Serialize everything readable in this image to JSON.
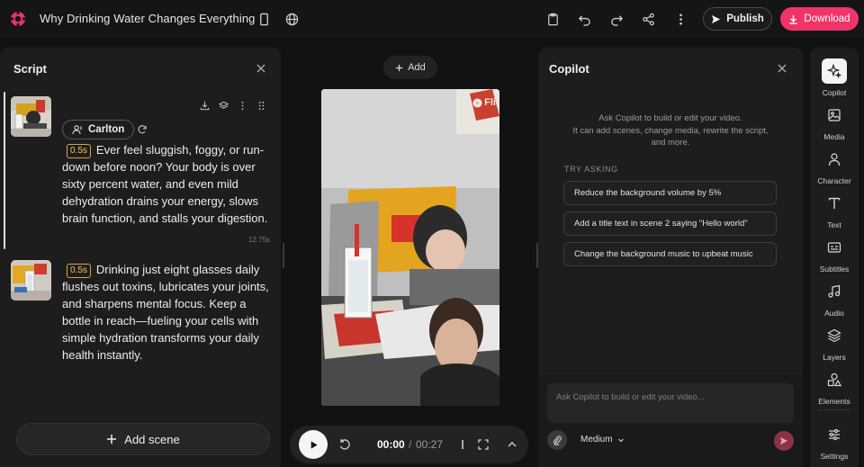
{
  "app": {
    "project_title": "Why Drinking Water Changes Everything",
    "publish_label": "Publish",
    "download_label": "Download",
    "brand_color": "#f0346a"
  },
  "script_panel": {
    "title": "Script",
    "scenes": [
      {
        "voice": "Carlton",
        "duration": "0.5s",
        "text": "Ever feel sluggish, foggy, or run-down before noon? Your body is over sixty percent water, and even mild dehydration drains your energy, slows brain function, and stalls your digestion.",
        "time": "12.75s"
      },
      {
        "duration": "0.5s",
        "text": "Drinking just eight glasses daily flushes out toxins, lubricates your joints, and sharpens mental focus. Keep a bottle in reach—fueling your cells with simple hydration transforms your daily health instantly."
      }
    ],
    "add_scene_label": "Add scene"
  },
  "center": {
    "add_label": "Add",
    "watermark": "Fli",
    "current_time": "00:00",
    "separator": "/",
    "total_time": "00:27"
  },
  "copilot": {
    "title": "Copilot",
    "intro_line1": "Ask Copilot to build or edit your video.",
    "intro_line2": "It can add scenes, change media, rewrite the script,",
    "intro_line3": "and more.",
    "try_asking_label": "TRY ASKING",
    "suggestions": [
      "Reduce the background volume by 5%",
      "Add a title text in scene 2 saying \"Hello world\"",
      "Change the background music to upbeat music"
    ],
    "input_placeholder": "Ask Copilot to build or edit your video...",
    "model": "Medium"
  },
  "rail": {
    "items": [
      {
        "label": "Copilot",
        "icon": "sparkle-icon"
      },
      {
        "label": "Media",
        "icon": "image-icon"
      },
      {
        "label": "Character",
        "icon": "person-icon"
      },
      {
        "label": "Text",
        "icon": "text-icon"
      },
      {
        "label": "Subtitles",
        "icon": "subtitles-icon"
      },
      {
        "label": "Audio",
        "icon": "music-icon"
      },
      {
        "label": "Layers",
        "icon": "layers-icon"
      },
      {
        "label": "Elements",
        "icon": "shapes-icon"
      },
      {
        "label": "Settings",
        "icon": "sliders-icon"
      }
    ]
  }
}
